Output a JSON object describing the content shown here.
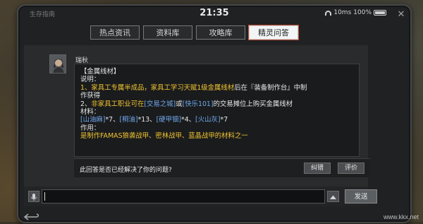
{
  "status": {
    "left_label": "生存指南",
    "time": "21:35",
    "network": "10ms",
    "battery": "100%"
  },
  "tabs": [
    {
      "label": "热点资讯",
      "active": false
    },
    {
      "label": "资料库",
      "active": false
    },
    {
      "label": "攻略库",
      "active": false
    },
    {
      "label": "精灵问答",
      "active": true
    }
  ],
  "sender": "瑞秋",
  "message": {
    "line1": "【金属线材】",
    "line2": "说明：",
    "line3a": "1、家具工专属半成品，家具工学习",
    "line3b": "天赋1级金属线材",
    "line3c": "后在『装备制作台』中制",
    "line4": "作获得",
    "line5a": "2、",
    "line5b": "非家具工职业可在",
    "line5c": "[交易之城]",
    "line5d": "或",
    "line5e": "[快乐101]",
    "line5f": "的交易摊位上购买金属线材",
    "line6": "材料：",
    "line7a": "[山油麻]",
    "line7b": "*7、",
    "line7c": "[桐油]",
    "line7d": "*13、",
    "line7e": "[硬甲钿]",
    "line7f": "*4、",
    "line7g": "[火山灰]",
    "line7h": "*7",
    "line8": "作用：",
    "line9a": "是制作",
    "line9b": "FAMAS狼袭战甲、密林战甲、蓝晶战甲的材料之一"
  },
  "feedback": {
    "question": "此回答是否已经解决了你的问题?",
    "correct_label": "纠错",
    "rate_label": "评价"
  },
  "input": {
    "send_label": "发送",
    "value": ""
  },
  "watermark": "www.kkx.net",
  "colors": {
    "highlight_yellow": "#f2c533",
    "highlight_blue": "#6fa9f0",
    "active_tab_border": "#c24b2e"
  }
}
